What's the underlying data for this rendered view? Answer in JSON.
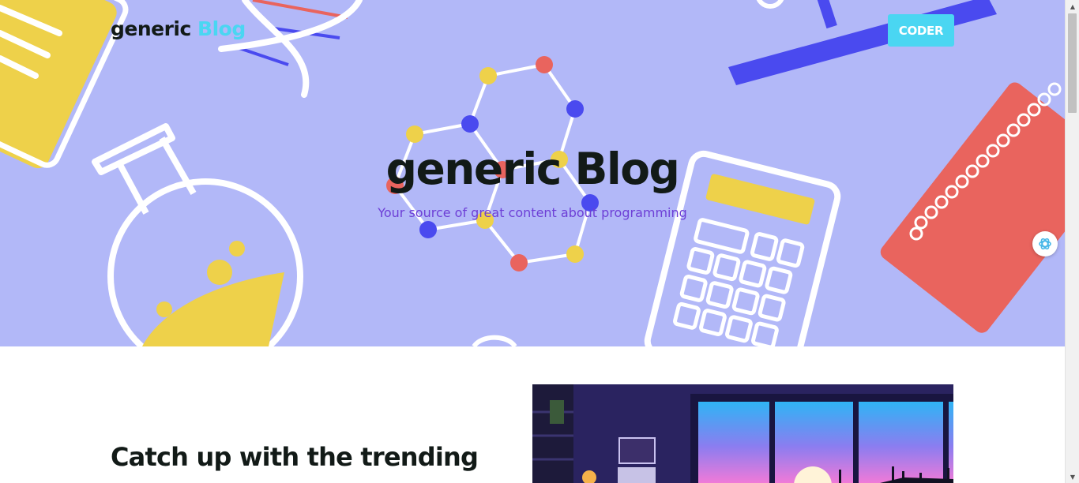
{
  "header": {
    "brand_main": "generic",
    "brand_accent": "Blog",
    "cta_label": "CODER"
  },
  "hero": {
    "title": "generic Blog",
    "subtitle": "Your source of great content about programming"
  },
  "content": {
    "section_title": "Catch up with the trending"
  },
  "colors": {
    "hero_bg": "#b2b8f8",
    "accent": "#4ad6f2",
    "subtitle": "#6d3fd6",
    "yellow": "#eed14a",
    "red": "#e9645e",
    "blue": "#4a4aef"
  },
  "icons": {
    "assistant": "assistant-swirl-icon",
    "scroll_up": "scroll-up-arrow-icon",
    "scroll_down": "scroll-down-arrow-icon"
  }
}
